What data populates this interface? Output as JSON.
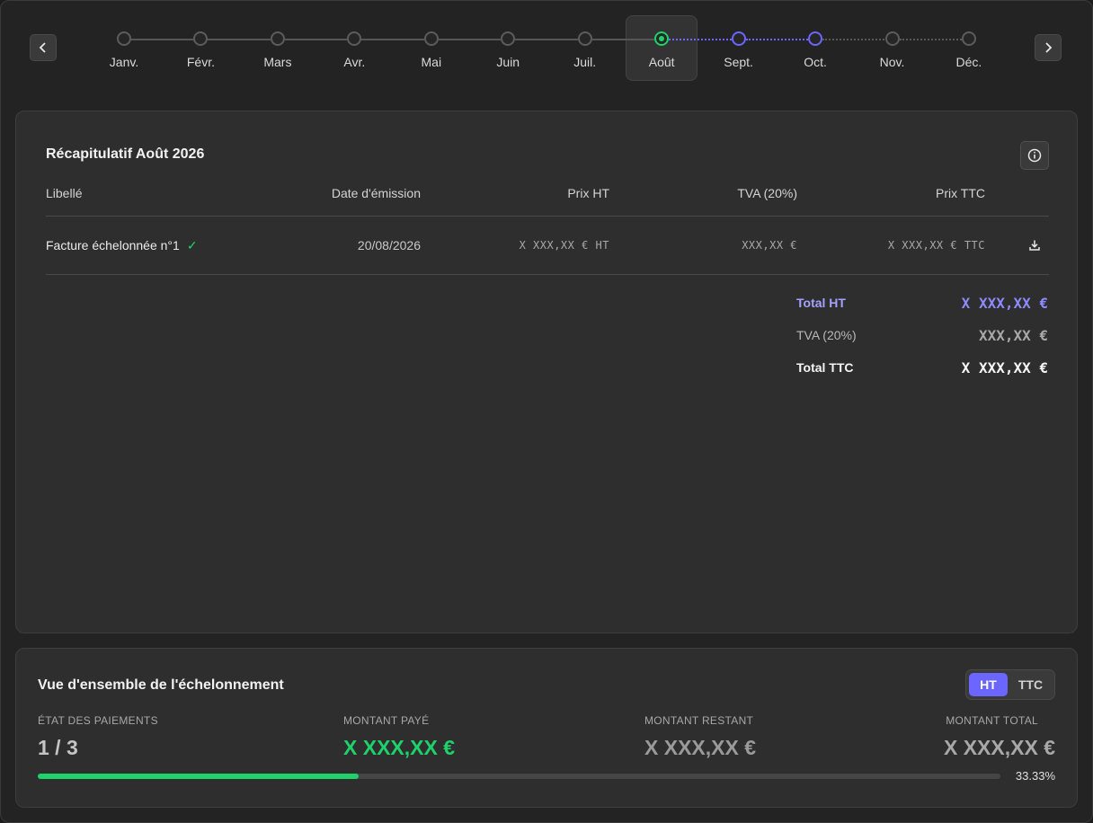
{
  "months": [
    {
      "label": "Janv.",
      "state": "past"
    },
    {
      "label": "Févr.",
      "state": "past"
    },
    {
      "label": "Mars",
      "state": "past"
    },
    {
      "label": "Avr.",
      "state": "past"
    },
    {
      "label": "Mai",
      "state": "past"
    },
    {
      "label": "Juin",
      "state": "past"
    },
    {
      "label": "Juil.",
      "state": "past"
    },
    {
      "label": "Août",
      "state": "current"
    },
    {
      "label": "Sept.",
      "state": "upcoming"
    },
    {
      "label": "Oct.",
      "state": "upcoming"
    },
    {
      "label": "Nov.",
      "state": "past"
    },
    {
      "label": "Déc.",
      "state": "past"
    }
  ],
  "icons": {
    "prev": "chevron-left-icon",
    "next": "chevron-right-icon",
    "info": "info-icon",
    "download": "download-icon",
    "check": "check-icon"
  },
  "colors": {
    "accent": "#6b66ff",
    "success": "#1fd16a",
    "muted": "#a8a8a8"
  },
  "recap": {
    "title": "Récapitulatif Août 2026",
    "headers": {
      "label": "Libellé",
      "date": "Date d'émission",
      "ht": "Prix HT",
      "tva": "TVA (20%)",
      "ttc": "Prix TTC"
    },
    "rows": [
      {
        "label": "Facture échelonnée n°1",
        "check": "✓",
        "date": "20/08/2026",
        "ht": "X XXX,XX € HT",
        "tva": "XXX,XX €",
        "ttc": "X XXX,XX € TTC"
      }
    ],
    "totals": {
      "ht_label": "Total HT",
      "ht_value": "X XXX,XX €",
      "tva_label": "TVA (20%)",
      "tva_value": "XXX,XX €",
      "ttc_label": "Total TTC",
      "ttc_value": "X XXX,XX €"
    }
  },
  "overview": {
    "title": "Vue d'ensemble de l'échelonnement",
    "toggle": {
      "ht": "HT",
      "ttc": "TTC",
      "selected": "HT"
    },
    "status_label": "ÉTAT DES PAIEMENTS",
    "status_value": "1 / 3",
    "paid_label": "MONTANT PAYÉ",
    "paid_value": "X XXX,XX €",
    "remaining_label": "MONTANT RESTANT",
    "remaining_value": "X XXX,XX €",
    "total_label": "MONTANT TOTAL",
    "total_value": "X XXX,XX €",
    "progress": 0.3333,
    "progress_text": "33.33%"
  }
}
